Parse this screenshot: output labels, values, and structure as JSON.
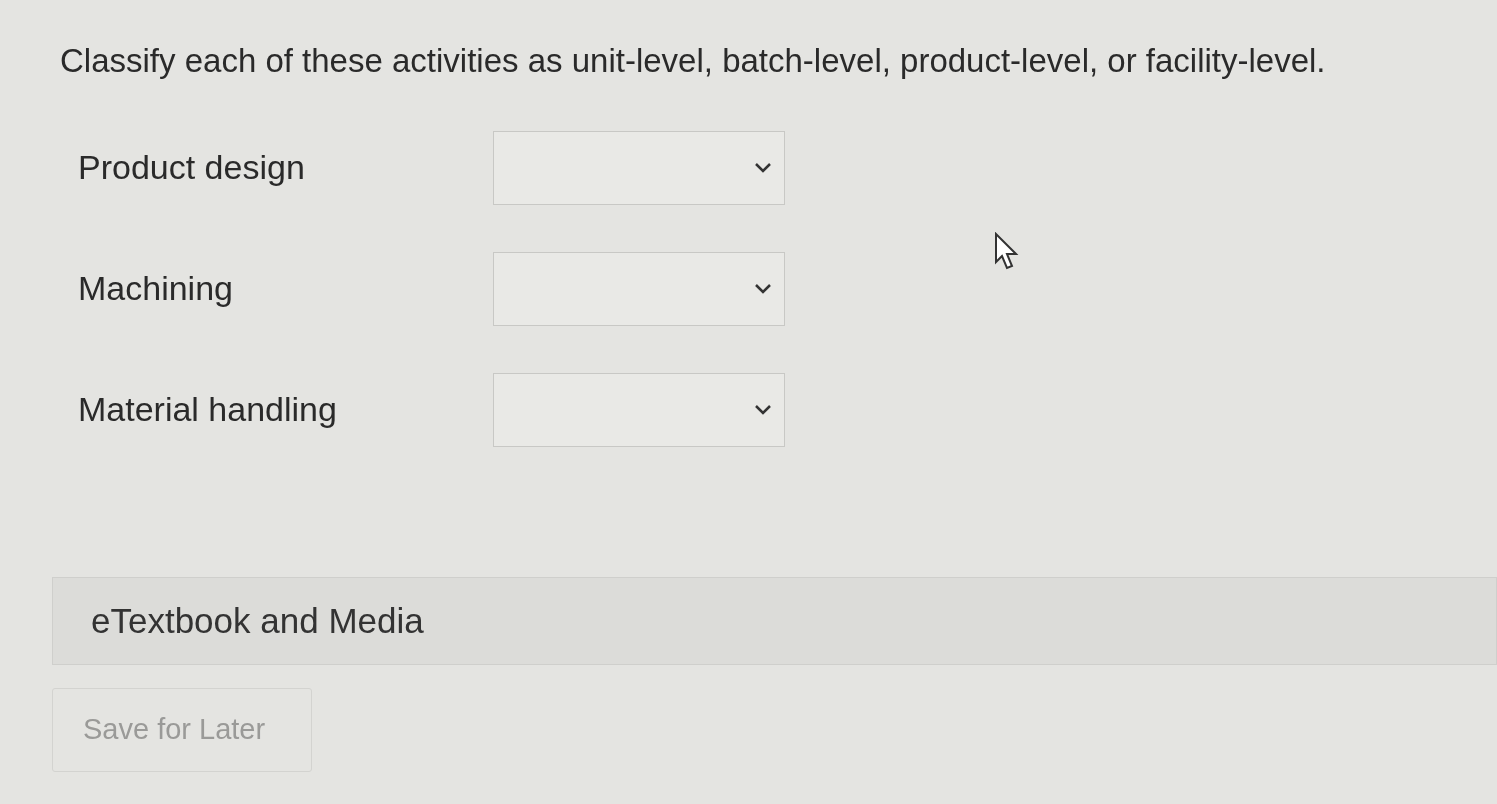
{
  "question": "Classify each of these activities as unit-level, batch-level, product-level, or facility-level.",
  "rows": [
    {
      "label": "Product design"
    },
    {
      "label": "Machining"
    },
    {
      "label": "Material handling"
    }
  ],
  "resources_panel": {
    "title": "eTextbook and Media"
  },
  "save_button": {
    "label": "Save for Later",
    "disabled": true
  }
}
